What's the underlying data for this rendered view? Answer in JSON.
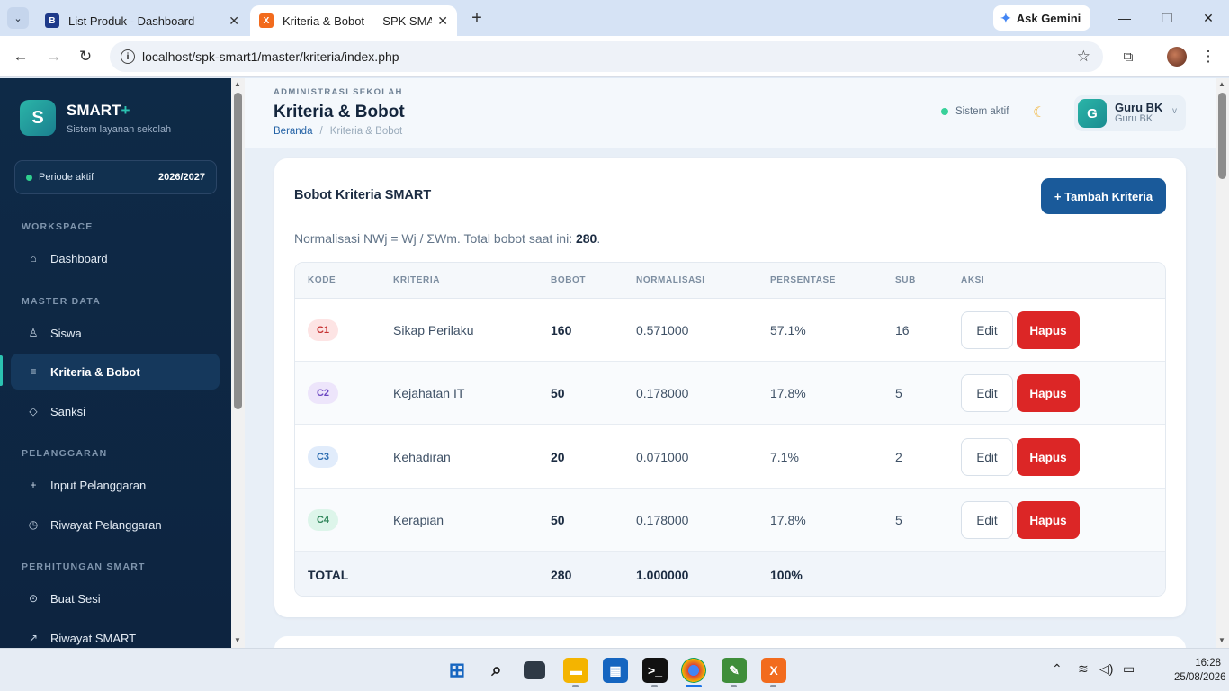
{
  "browser": {
    "tabs": [
      {
        "title": "List Produk - Dashboard",
        "favicon": "B"
      },
      {
        "title": "Kriteria & Bobot — SPK SMART",
        "favicon": "X"
      }
    ],
    "gemini_label": "Ask Gemini",
    "url": "localhost/spk-smart1/master/kriteria/index.php"
  },
  "sidebar": {
    "logo_letter": "S",
    "brand": "SMART",
    "brand_plus": "+",
    "subtitle": "Sistem layanan sekolah",
    "period_label": "Periode aktif",
    "period_value": "2026/2027",
    "sections": {
      "workspace": "WORKSPACE",
      "master": "MASTER DATA",
      "pelanggaran": "PELANGGARAN",
      "smart": "PERHITUNGAN SMART"
    },
    "items": [
      {
        "label": "Dashboard",
        "icon": "⌂"
      },
      {
        "label": "Siswa",
        "icon": "♙"
      },
      {
        "label": "Kriteria & Bobot",
        "icon": "≡"
      },
      {
        "label": "Sanksi",
        "icon": "◇"
      },
      {
        "label": "Input Pelanggaran",
        "icon": "+"
      },
      {
        "label": "Riwayat Pelanggaran",
        "icon": "◷"
      },
      {
        "label": "Buat Sesi",
        "icon": "⊙"
      },
      {
        "label": "Riwayat SMART",
        "icon": "↗"
      }
    ]
  },
  "header": {
    "kicker": "ADMINISTRASI SEKOLAH",
    "title": "Kriteria & Bobot",
    "breadcrumb_home": "Beranda",
    "breadcrumb_sep": "/",
    "breadcrumb_current": "Kriteria & Bobot",
    "status": "Sistem aktif",
    "user_initial": "G",
    "user_name": "Guru BK",
    "user_role": "Guru BK"
  },
  "card": {
    "title": "Bobot Kriteria SMART",
    "add_button": "+ Tambah Kriteria",
    "note_prefix": "Normalisasi NWj = Wj / ΣWm. Total bobot saat ini: ",
    "note_total": "280",
    "note_suffix": "."
  },
  "table": {
    "headers": [
      "KODE",
      "KRITERIA",
      "BOBOT",
      "NORMALISASI",
      "PERSENTASE",
      "SUB",
      "AKSI"
    ],
    "rows": [
      {
        "kode": "C1",
        "kriteria": "Sikap Perilaku",
        "bobot": "160",
        "normalisasi": "0.571000",
        "persentase": "57.1%",
        "sub": "16",
        "edit": "Edit",
        "hapus": "Hapus",
        "badge_bg": "#fde4e4",
        "badge_fg": "#c53030"
      },
      {
        "kode": "C2",
        "kriteria": "Kejahatan IT",
        "bobot": "50",
        "normalisasi": "0.178000",
        "persentase": "17.8%",
        "sub": "5",
        "edit": "Edit",
        "hapus": "Hapus",
        "badge_bg": "#ede5fb",
        "badge_fg": "#6b46c1"
      },
      {
        "kode": "C3",
        "kriteria": "Kehadiran",
        "bobot": "20",
        "normalisasi": "0.071000",
        "persentase": "7.1%",
        "sub": "2",
        "edit": "Edit",
        "hapus": "Hapus",
        "badge_bg": "#e1ecfb",
        "badge_fg": "#2b6cb0"
      },
      {
        "kode": "C4",
        "kriteria": "Kerapian",
        "bobot": "50",
        "normalisasi": "0.178000",
        "persentase": "17.8%",
        "sub": "5",
        "edit": "Edit",
        "hapus": "Hapus",
        "badge_bg": "#ddf5ea",
        "badge_fg": "#2f855a"
      }
    ],
    "footer": {
      "label": "TOTAL",
      "bobot": "280",
      "normalisasi": "1.000000",
      "persentase": "100%"
    }
  },
  "taskbar": {
    "time": "16:28",
    "date": "25/08/2026"
  },
  "colors": {
    "accent": "#1a5a9a",
    "danger": "#dc2626",
    "sidebar": "#0e2a47",
    "teal": "#2bc2b1"
  }
}
